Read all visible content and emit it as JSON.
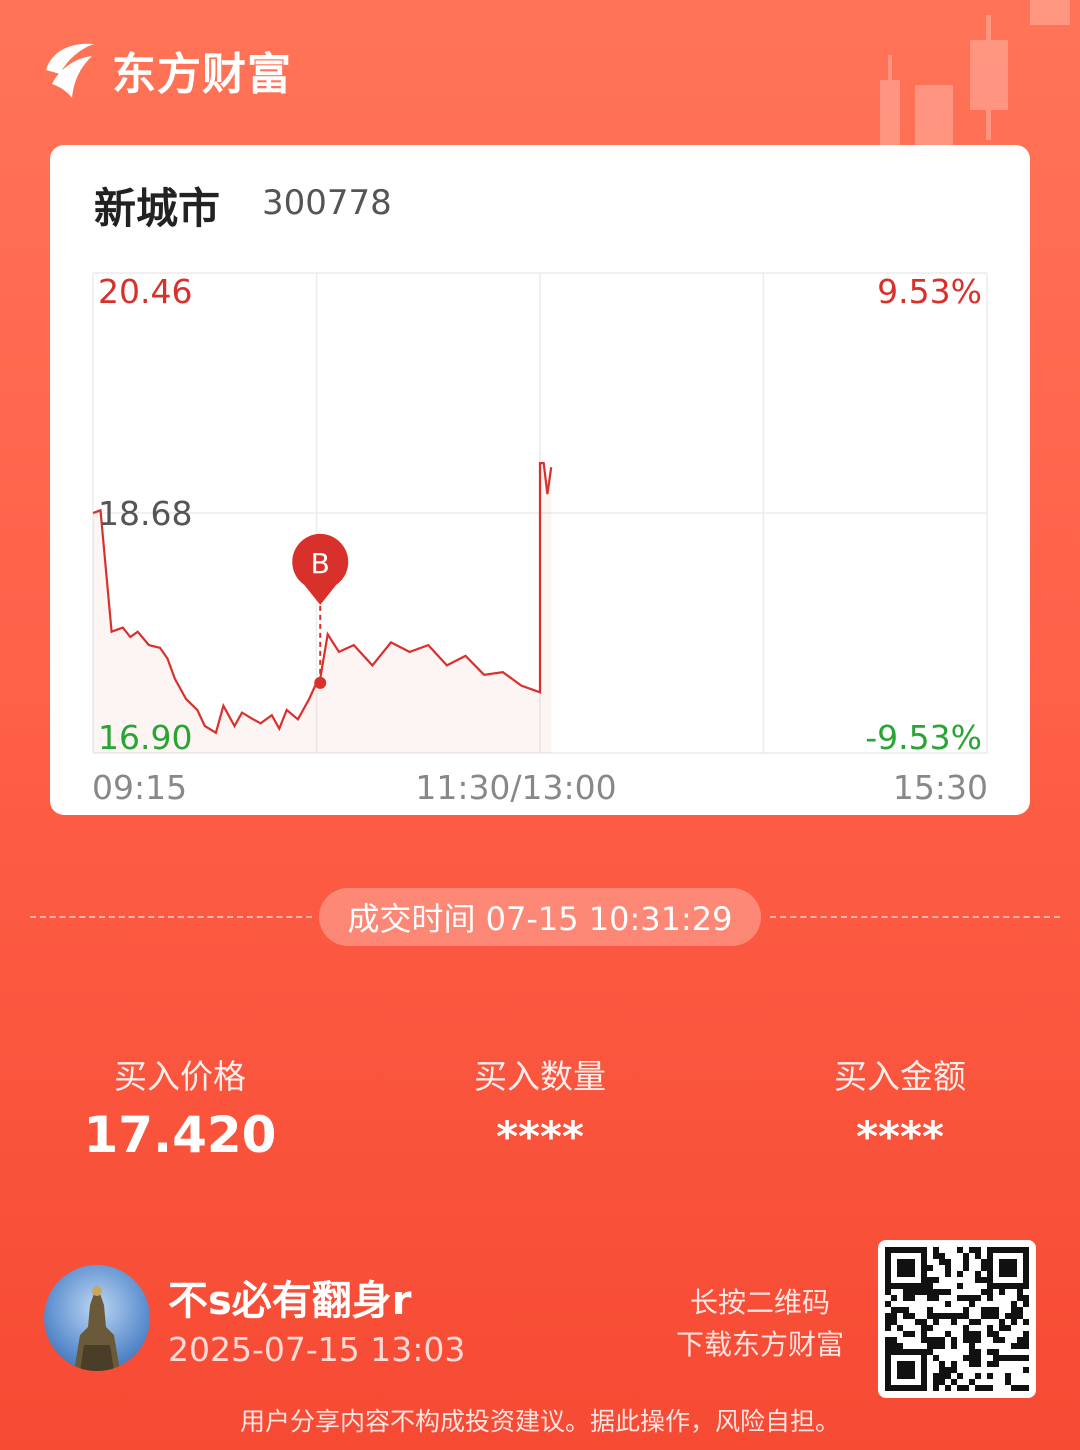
{
  "brand": {
    "name": "东方财富"
  },
  "stock": {
    "name": "新城市",
    "code": "300778"
  },
  "chart_data": {
    "type": "line",
    "y_axis": {
      "top": "20.46",
      "mid": "18.68",
      "bottom": "16.90",
      "ylim": [
        16.9,
        20.46
      ]
    },
    "pct_axis": {
      "top": "9.53%",
      "bottom": "-9.53%"
    },
    "x_ticks": [
      "09:15",
      "11:30/13:00",
      "15:30"
    ],
    "buy_marker": {
      "label": "B",
      "time": "10:31",
      "price": 17.42
    },
    "series": [
      {
        "x": [
          "09:30",
          "09:31",
          "09:32",
          "09:33",
          "09:35",
          "09:38",
          "09:40",
          "09:42",
          "09:45",
          "09:48",
          "09:50",
          "09:52",
          "09:55",
          "09:58",
          "10:00",
          "10:03",
          "10:05",
          "10:08",
          "10:10",
          "10:13",
          "10:15",
          "10:18",
          "10:20",
          "10:22",
          "10:25",
          "10:28",
          "10:30",
          "10:31",
          "10:33",
          "10:36",
          "10:40",
          "10:45",
          "10:50",
          "10:55",
          "11:00",
          "11:05",
          "11:10",
          "11:15",
          "11:20",
          "11:25",
          "11:30",
          "13:00",
          "13:01",
          "13:02",
          "13:03"
        ],
        "values": [
          18.68,
          18.69,
          18.7,
          18.4,
          17.8,
          17.83,
          17.76,
          17.8,
          17.7,
          17.68,
          17.6,
          17.45,
          17.3,
          17.22,
          17.1,
          17.05,
          17.25,
          17.1,
          17.2,
          17.15,
          17.12,
          17.18,
          17.08,
          17.22,
          17.15,
          17.3,
          17.42,
          17.45,
          17.78,
          17.65,
          17.7,
          17.55,
          17.72,
          17.65,
          17.7,
          17.55,
          17.62,
          17.48,
          17.5,
          17.4,
          17.35,
          19.05,
          19.05,
          18.82,
          19.02
        ]
      }
    ]
  },
  "trade": {
    "time_label": "成交时间 07-15 10:31:29"
  },
  "stats": [
    {
      "label": "买入价格",
      "value": "17.420"
    },
    {
      "label": "买入数量",
      "value": "****"
    },
    {
      "label": "买入金额",
      "value": "****"
    }
  ],
  "user": {
    "name": "不s必有翻身r",
    "time": "2025-07-15 13:03"
  },
  "qr": {
    "hint_line1": "长按二维码",
    "hint_line2": "下载东方财富"
  },
  "footer": {
    "disclaimer": "用户分享内容不构成投资建议。据此操作，风险自担。"
  },
  "colors": {
    "up": "#d8312b",
    "down": "#2aa534",
    "accent": "#ff6149"
  }
}
